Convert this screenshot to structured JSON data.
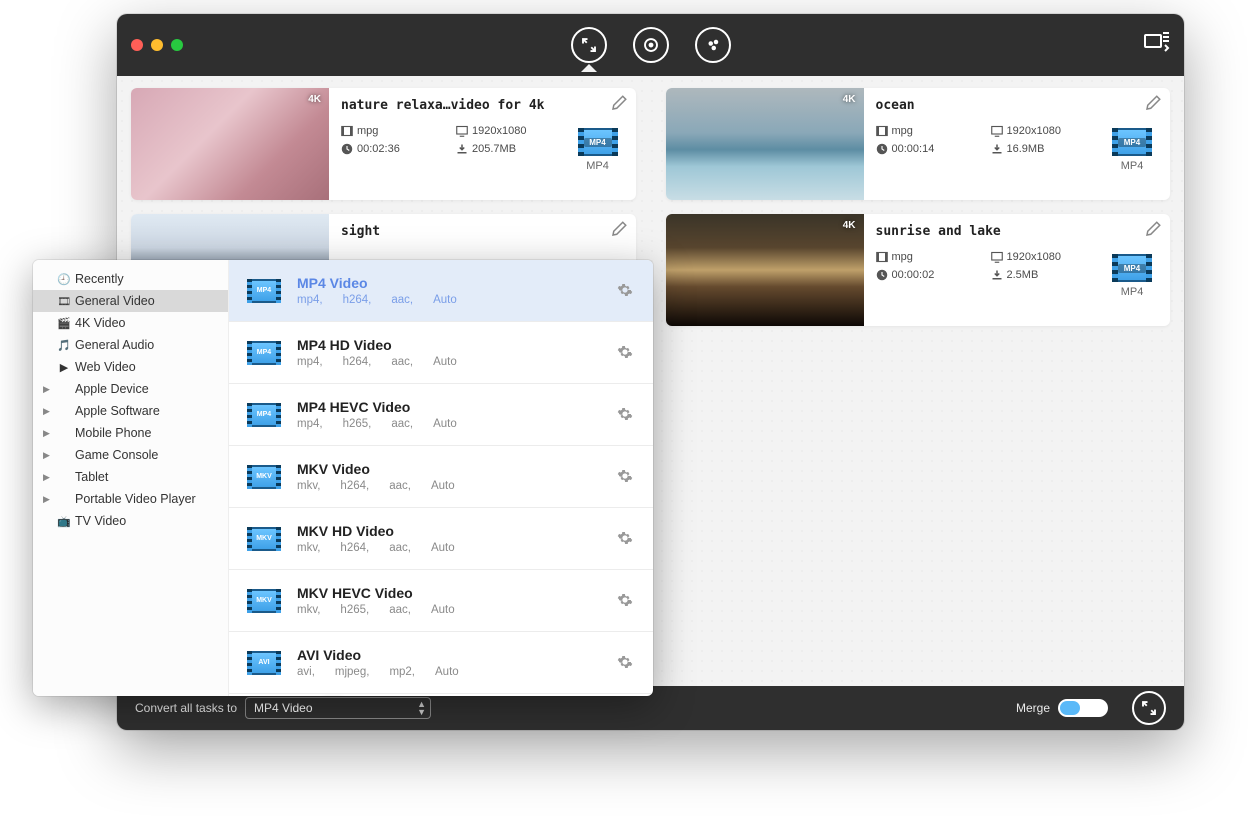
{
  "titlebar": {
    "icons": [
      "convert",
      "rip-dvd",
      "download"
    ]
  },
  "videos": [
    {
      "title": "nature relaxa…video for 4k",
      "format": "mpg",
      "resolution": "1920x1080",
      "duration": "00:02:36",
      "size": "205.7MB",
      "output": "MP4",
      "badge4k": "4K",
      "thumb_css": "linear-gradient(135deg,#d7a8b5 0%,#e8c5cc 40%,#c38a94 70%,#a8707a 100%)"
    },
    {
      "title": "ocean",
      "format": "mpg",
      "resolution": "1920x1080",
      "duration": "00:00:14",
      "size": "16.9MB",
      "output": "MP4",
      "badge4k": "4K",
      "thumb_css": "linear-gradient(180deg,#aeb8bd 0%,#8aa8b8 40%,#5d8da3 55%,#9ec7d6 70%,#c8dde5 100%)"
    },
    {
      "title": "sight",
      "format": "",
      "resolution": "",
      "duration": "",
      "size": "",
      "output": "",
      "badge4k": "",
      "thumb_css": "linear-gradient(180deg,#dfe9f2 0%,#cfd9e5 30%,#6a7a8a 55%,#3d4a5c 100%)"
    },
    {
      "title": "sunrise and lake",
      "format": "mpg",
      "resolution": "1920x1080",
      "duration": "00:00:02",
      "size": "2.5MB",
      "output": "MP4",
      "badge4k": "4K",
      "thumb_css": "linear-gradient(180deg,#3a3428 0%,#58452e 30%,#bfa06a 50%,#654a2e 65%,#0d0805 100%)"
    }
  ],
  "bottombar": {
    "convert_label": "Convert all tasks to",
    "select_value": "MP4 Video",
    "merge_label": "Merge"
  },
  "popover": {
    "categories": [
      {
        "label": "Recently",
        "icon": "clock",
        "expand": false
      },
      {
        "label": "General Video",
        "icon": "video",
        "expand": false,
        "selected": true
      },
      {
        "label": "4K Video",
        "icon": "4k",
        "expand": false
      },
      {
        "label": "General Audio",
        "icon": "audio",
        "expand": false
      },
      {
        "label": "Web Video",
        "icon": "web",
        "expand": false
      },
      {
        "label": "Apple Device",
        "expand": true
      },
      {
        "label": "Apple Software",
        "expand": true
      },
      {
        "label": "Mobile Phone",
        "expand": true
      },
      {
        "label": "Game Console",
        "expand": true
      },
      {
        "label": "Tablet",
        "expand": true
      },
      {
        "label": "Portable Video Player",
        "expand": true
      },
      {
        "label": "TV Video",
        "icon": "tv",
        "expand": false
      }
    ],
    "formats": [
      {
        "title": "MP4 Video",
        "sub": [
          "mp4,",
          "h264,",
          "aac,",
          "Auto"
        ],
        "tag": "MP4",
        "selected": true
      },
      {
        "title": "MP4 HD Video",
        "sub": [
          "mp4,",
          "h264,",
          "aac,",
          "Auto"
        ],
        "tag": "MP4"
      },
      {
        "title": "MP4 HEVC Video",
        "sub": [
          "mp4,",
          "h265,",
          "aac,",
          "Auto"
        ],
        "tag": "MP4"
      },
      {
        "title": "MKV Video",
        "sub": [
          "mkv,",
          "h264,",
          "aac,",
          "Auto"
        ],
        "tag": "MKV"
      },
      {
        "title": "MKV HD Video",
        "sub": [
          "mkv,",
          "h264,",
          "aac,",
          "Auto"
        ],
        "tag": "MKV"
      },
      {
        "title": "MKV HEVC Video",
        "sub": [
          "mkv,",
          "h265,",
          "aac,",
          "Auto"
        ],
        "tag": "MKV"
      },
      {
        "title": "AVI Video",
        "sub": [
          "avi,",
          "mjpeg,",
          "mp2,",
          "Auto"
        ],
        "tag": "AVI"
      }
    ]
  }
}
